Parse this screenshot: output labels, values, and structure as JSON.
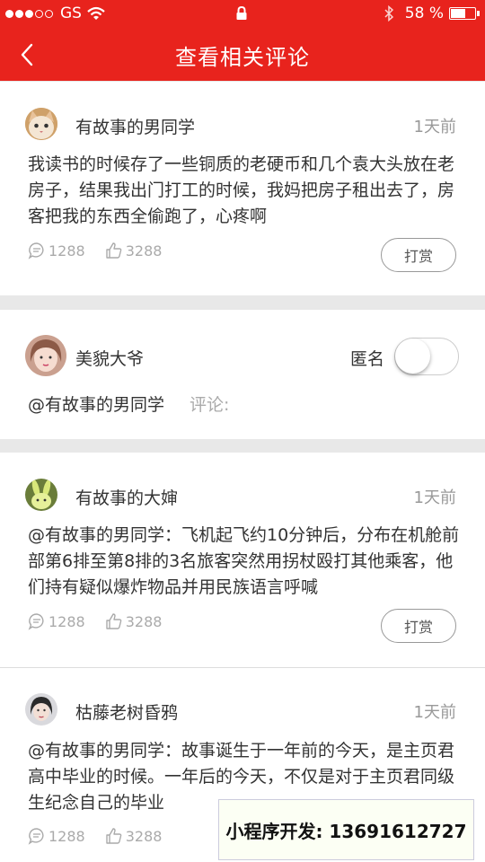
{
  "status_bar": {
    "carrier": "GS",
    "battery_percent": "58 %",
    "signal_dots_filled": 3,
    "signal_dots_total": 5
  },
  "nav": {
    "title": "查看相关评论",
    "back_icon": "chevron-left-icon"
  },
  "colors": {
    "brand_red": "#e8231d",
    "text": "#333333",
    "muted": "#999999"
  },
  "main_comment": {
    "user": "有故事的男同学",
    "time": "1天前",
    "text": "我读书的时候存了一些铜质的老硬币和几个袁大头放在老房子，结果我出门打工的时候，我妈把房子租出去了，房客把我的东西全偷跑了，心疼啊",
    "comments": "1288",
    "likes": "3288",
    "reward_label": "打赏"
  },
  "compose": {
    "user": "美貌大爷",
    "anonymous_label": "匿名",
    "anonymous_on": false,
    "reply_to": "@有故事的男同学",
    "comment_placeholder": "评论:"
  },
  "replies": [
    {
      "user": "有故事的大婶",
      "time": "1天前",
      "text": "@有故事的男同学：飞机起飞约10分钟后，分布在机舱前部第6排至第8排的3名旅客突然用拐杖殴打其他乘客，他们持有疑似爆炸物品并用民族语言呼喊",
      "comments": "1288",
      "likes": "3288",
      "reward_label": "打赏"
    },
    {
      "user": "枯藤老树昏鸦",
      "time": "1天前",
      "text": "@有故事的男同学：故事诞生于一年前的今天，是主页君高中毕业的时候。一年后的今天，不仅是对于主页君同级生纪念自己的毕业",
      "comments": "1288",
      "likes": "3288"
    }
  ],
  "watermark": "小程序开发: 13691612727"
}
